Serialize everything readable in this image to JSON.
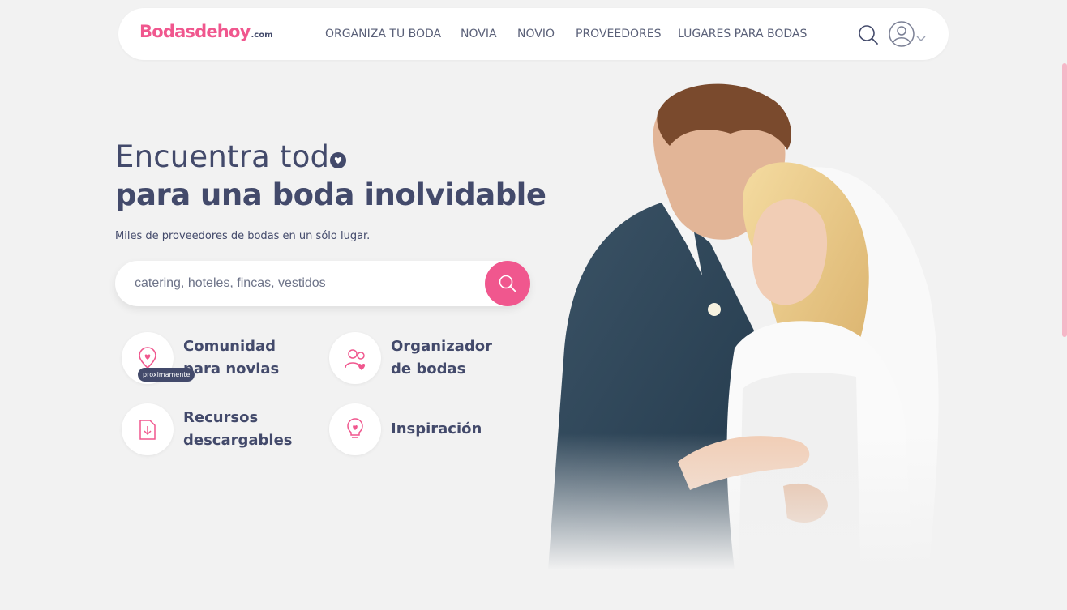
{
  "header": {
    "logo_main": "Bodasdehoy",
    "logo_suffix": ".com",
    "nav": [
      {
        "label": "ORGANIZA TU BODA"
      },
      {
        "label": "NOVIA"
      },
      {
        "label": "NOVIO"
      },
      {
        "label": "PROVEEDORES"
      },
      {
        "label": "LUGARES PARA BODAS"
      }
    ],
    "icons": {
      "search": "search-icon",
      "user": "user-avatar-icon",
      "dropdown": "chevron-down-icon"
    }
  },
  "hero": {
    "title_line1": "Encuentra tod",
    "title_line2": "para una boda inolvidable",
    "subtitle": "Miles de proveedores de bodas en un sólo lugar."
  },
  "search": {
    "placeholder": "catering, hoteles, fincas, vestidos",
    "value": ""
  },
  "features": [
    {
      "line1": "Comunidad",
      "line2": "para novias",
      "badge": "proximamente",
      "icon": "heart-pin-icon"
    },
    {
      "line1": "Organizador",
      "line2": "de bodas",
      "icon": "couple-icon"
    },
    {
      "line1": "Recursos",
      "line2": "descargables",
      "icon": "download-file-icon"
    },
    {
      "line1": "Inspiración",
      "icon": "heart-lightbulb-icon"
    }
  ],
  "colors": {
    "accent": "#f0578e",
    "text": "#434a6b",
    "background": "#f2f2f2"
  },
  "image": {
    "subject": "couple-photo"
  }
}
